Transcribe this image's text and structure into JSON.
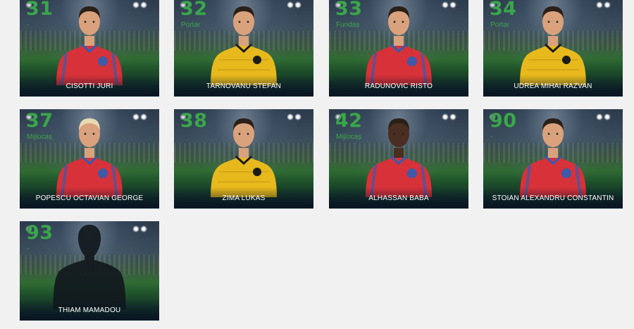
{
  "colors": {
    "number": "#3aa64a",
    "kit_home": "#d7313a",
    "kit_home_trim": "#2f5fb4",
    "kit_keeper": "#e8b91c",
    "skin": "#d9a27d",
    "hair_dark": "#2a2018",
    "hair_blond": "#e7d9b4",
    "silhouette": "#11181d"
  },
  "players": [
    {
      "number": "31",
      "position": "-",
      "name": "CISOTTI JURI",
      "kit": "home",
      "hair": "dark",
      "icon": "player-photo"
    },
    {
      "number": "32",
      "position": "Portar",
      "name": "TARNOVANU STEFAN",
      "kit": "keeper",
      "hair": "dark",
      "icon": "player-photo"
    },
    {
      "number": "33",
      "position": "Fundaș",
      "name": "RADUNOVIC RISTO",
      "kit": "home",
      "hair": "dark",
      "icon": "player-photo"
    },
    {
      "number": "34",
      "position": "Portar",
      "name": "UDREA MIHAI RAZVAN",
      "kit": "keeper",
      "hair": "dark",
      "icon": "player-photo"
    },
    {
      "number": "37",
      "position": "Mijlocaș",
      "name": "POPESCU OCTAVIAN GEORGE",
      "kit": "home",
      "hair": "blond",
      "icon": "player-photo"
    },
    {
      "number": "38",
      "position": "",
      "name": "ZIMA LUKAS",
      "kit": "keeper",
      "hair": "dark",
      "icon": "player-photo"
    },
    {
      "number": "42",
      "position": "Mijlocaș",
      "name": "ALHASSAN BABA",
      "kit": "home",
      "hair": "dark",
      "skin": "dark",
      "icon": "player-photo"
    },
    {
      "number": "90",
      "position": "-",
      "name": "STOIAN ALEXANDRU CONSTANTIN",
      "kit": "home",
      "hair": "dark",
      "icon": "player-photo"
    },
    {
      "number": "93",
      "position": "-",
      "name": "THIAM MAMADOU",
      "kit": "silhouette",
      "hair": "none",
      "icon": "silhouette-placeholder"
    }
  ]
}
